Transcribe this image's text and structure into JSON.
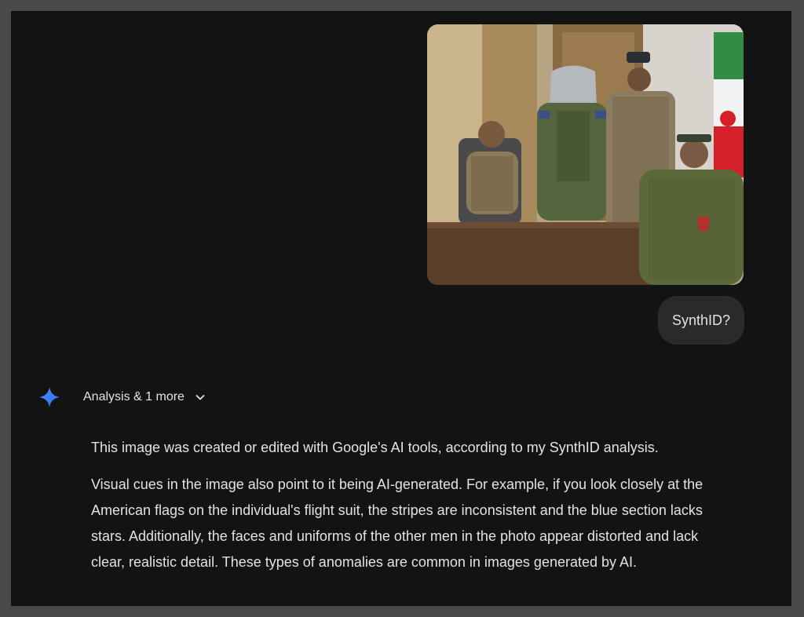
{
  "conversation": {
    "user_message": {
      "image_alt": "Uploaded photo of men in military uniforms",
      "text": "SynthID?"
    },
    "model_response": {
      "tools_label": "Analysis & 1 more",
      "paragraphs": [
        "This image was created or edited with Google's AI tools, according to my SynthID analysis.",
        "Visual cues in the image also point to it being AI-generated. For example, if you look closely at the American flags on the individual's flight suit, the stripes are inconsistent and the blue section lacks stars. Additionally, the faces and uniforms of the other men in the photo appear distorted and lack clear, realistic detail. These types of anomalies are common in images generated by AI."
      ]
    }
  },
  "icons": {
    "model_avatar": "gemini-sparkle-icon",
    "expand": "chevron-down-icon"
  },
  "colors": {
    "background": "#131314",
    "outer_frame": "#4a4a4a",
    "bubble": "#282a2c",
    "text": "#e3e3e3",
    "sparkle_blue": "#4285f4"
  }
}
